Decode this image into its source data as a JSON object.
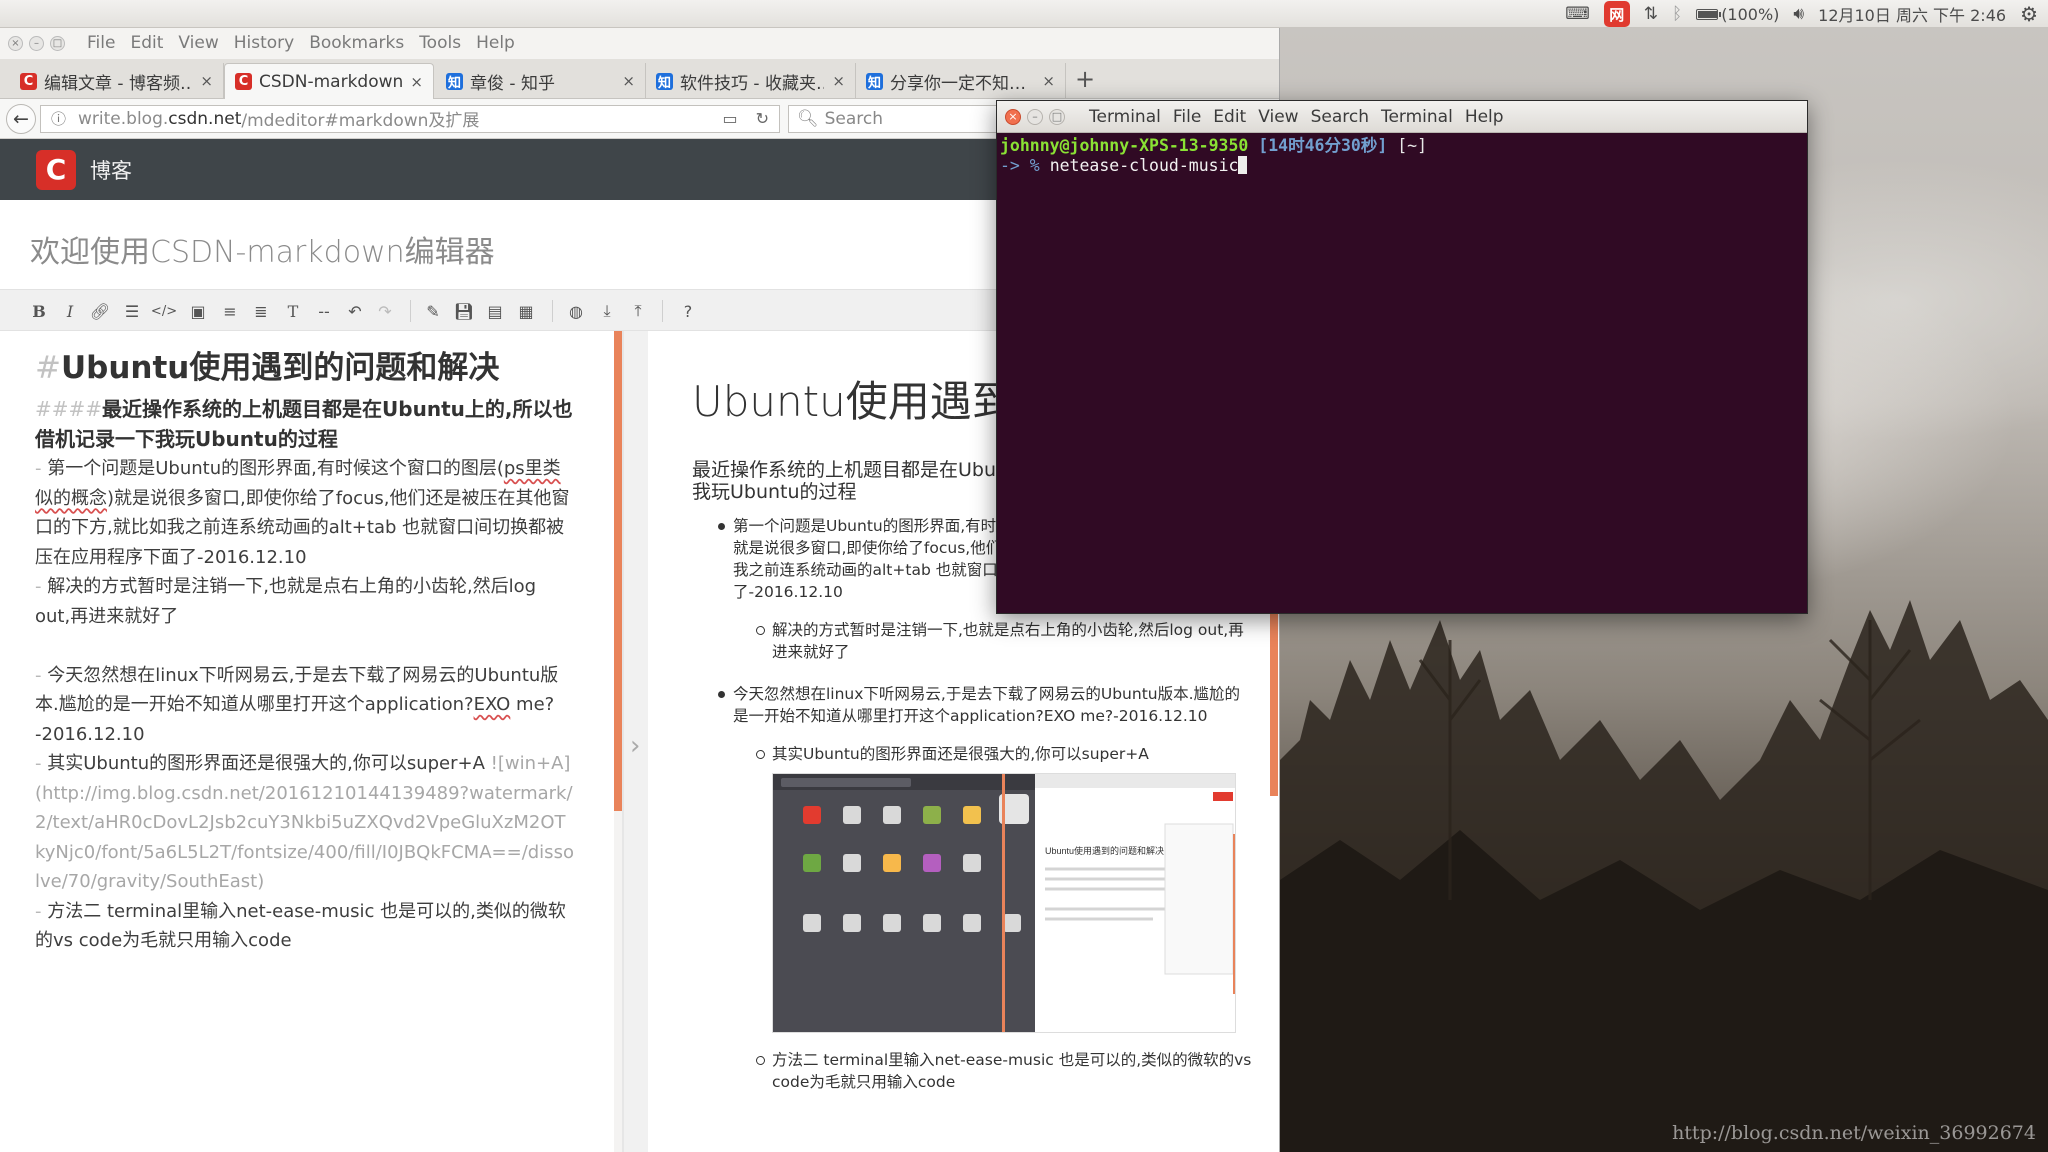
{
  "panel": {
    "battery": "(100%)",
    "datetime": "12月10日 周六 下午 2:46",
    "netease_icon": "网"
  },
  "browser": {
    "menu": [
      "File",
      "Edit",
      "View",
      "History",
      "Bookmarks",
      "Tools",
      "Help"
    ],
    "tabs": [
      {
        "icon": "C",
        "kind": "csdn",
        "title": "编辑文章 - 博客频…",
        "active": false
      },
      {
        "icon": "C",
        "kind": "csdn",
        "title": "CSDN-markdown…",
        "active": true
      },
      {
        "icon": "知",
        "kind": "zhihu",
        "title": "章俊 - 知乎",
        "active": false
      },
      {
        "icon": "知",
        "kind": "zhihu",
        "title": "软件技巧 - 收藏夹…",
        "active": false
      },
      {
        "icon": "知",
        "kind": "zhihu",
        "title": "分享你一定不知…",
        "active": false
      }
    ],
    "url_prefix": "write.blog.",
    "url_host": "csdn.net",
    "url_path": "/mdeditor#markdown及扩展",
    "search_placeholder": "Search"
  },
  "csdn": {
    "logo": "C",
    "blog_label": "博客",
    "editor_title": "欢迎使用CSDN-markdown编辑器"
  },
  "editor": {
    "h1_mark": "#",
    "h1_text": "Ubuntu使用遇到的问题和解决",
    "h4_mark": "####",
    "h4_text": "最近操作系统的上机题目都是在Ubuntu上的,所以也借机记录一下我玩Ubuntu的过程",
    "lines": [
      {
        "mark": "- ",
        "text": "第一个问题是Ubuntu的图形界面,有时候这个窗口的图层(",
        "squiggle": "ps里类似的概念",
        "after": ")就是说很多窗口,即使你给了focus,他们还是被压在其他窗口的下方,就比如我之前连系统动画的alt+tab 也就窗口间切换都被压在应用程序下面了-2016.12.10"
      },
      {
        "mark": " - ",
        "text": "解决的方式暂时是注销一下,也就是点右上角的小齿轮,然后log out,再进来就好了",
        "squiggle": "",
        "after": ""
      },
      {
        "mark": "- ",
        "text": "今天忽然想在linux下听网易云,于是去下载了网易云的Ubuntu版本.尴尬的是一开始不知道从哪里打开这个application?",
        "squiggle": "EXO",
        "after": " me?-2016.12.10"
      },
      {
        "mark": " - ",
        "text": "其实Ubuntu的图形界面还是很强大的,你可以super+A ",
        "link": "![win+A](http://img.blog.csdn.net/20161210144139489?watermark/2/text/aHR0cDovL2Jsb2cuY3Nkbi5uZXQvd2VpeGluXzM2OTkyNjc0/font/5a6L5L2T/fontsize/400/fill/I0JBQkFCMA==/dissolve/70/gravity/SouthEast)"
      },
      {
        "mark": " - ",
        "text": "方法二 terminal里输入net-ease-music 也是可以的,类似的微软的vs code为毛就只用输入code"
      }
    ]
  },
  "preview": {
    "h1": "Ubuntu使用遇到的问题和解决",
    "h4": "最近操作系统的上机题目都是在Ubuntu上的,所以也借机记录一下我玩Ubuntu的过程",
    "li1": "第一个问题是Ubuntu的图形界面,有时候这个窗口的图层(ps里类似的概念)就是说很多窗口,即使你给了focus,他们还是被压在其他窗口的下方,就比如我之前连系统动画的alt+tab 也就窗口间切换都被压在应用程序下面了-2016.12.10",
    "li1_sub": "解决的方式暂时是注销一下,也就是点右上角的小齿轮,然后log out,再进来就好了",
    "li2": "今天忽然想在linux下听网易云,于是去下载了网易云的Ubuntu版本.尴尬的是一开始不知道从哪里打开这个application?EXO me?-2016.12.10",
    "li2_sub1": "其实Ubuntu的图形界面还是很强大的,你可以super+A",
    "li2_sub2": "方法二   terminal里输入net-ease-music   也是可以的,类似的微软的vs code为毛就只用输入code",
    "img_caption": "Ubuntu使用遇到的问题和解决"
  },
  "terminal": {
    "title": "Terminal",
    "menu": [
      "File",
      "Edit",
      "View",
      "Search",
      "Terminal",
      "Help"
    ],
    "user_host": "johnny@johnny-XPS-13-9350",
    "time": "[14时46分30秒]",
    "dir": "[~]",
    "prompt": "-> %",
    "command": "netease-cloud-music"
  },
  "watermark": "http://blog.csdn.net/weixin_36992674",
  "colors": {
    "terminal_bg": "#300a24",
    "csdn_red": "#d72f28",
    "accent_orange": "#e9835a",
    "header_dark": "#3f4549"
  }
}
